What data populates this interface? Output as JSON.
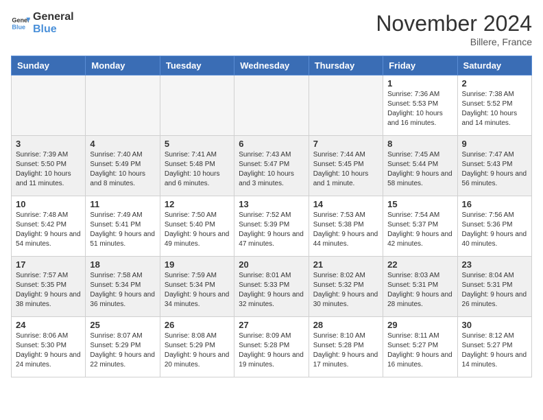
{
  "header": {
    "logo_general": "General",
    "logo_blue": "Blue",
    "month_title": "November 2024",
    "location": "Billere, France"
  },
  "weekdays": [
    "Sunday",
    "Monday",
    "Tuesday",
    "Wednesday",
    "Thursday",
    "Friday",
    "Saturday"
  ],
  "weeks": [
    [
      {
        "day": "",
        "info": ""
      },
      {
        "day": "",
        "info": ""
      },
      {
        "day": "",
        "info": ""
      },
      {
        "day": "",
        "info": ""
      },
      {
        "day": "",
        "info": ""
      },
      {
        "day": "1",
        "info": "Sunrise: 7:36 AM\nSunset: 5:53 PM\nDaylight: 10 hours and 16 minutes."
      },
      {
        "day": "2",
        "info": "Sunrise: 7:38 AM\nSunset: 5:52 PM\nDaylight: 10 hours and 14 minutes."
      }
    ],
    [
      {
        "day": "3",
        "info": "Sunrise: 7:39 AM\nSunset: 5:50 PM\nDaylight: 10 hours and 11 minutes."
      },
      {
        "day": "4",
        "info": "Sunrise: 7:40 AM\nSunset: 5:49 PM\nDaylight: 10 hours and 8 minutes."
      },
      {
        "day": "5",
        "info": "Sunrise: 7:41 AM\nSunset: 5:48 PM\nDaylight: 10 hours and 6 minutes."
      },
      {
        "day": "6",
        "info": "Sunrise: 7:43 AM\nSunset: 5:47 PM\nDaylight: 10 hours and 3 minutes."
      },
      {
        "day": "7",
        "info": "Sunrise: 7:44 AM\nSunset: 5:45 PM\nDaylight: 10 hours and 1 minute."
      },
      {
        "day": "8",
        "info": "Sunrise: 7:45 AM\nSunset: 5:44 PM\nDaylight: 9 hours and 58 minutes."
      },
      {
        "day": "9",
        "info": "Sunrise: 7:47 AM\nSunset: 5:43 PM\nDaylight: 9 hours and 56 minutes."
      }
    ],
    [
      {
        "day": "10",
        "info": "Sunrise: 7:48 AM\nSunset: 5:42 PM\nDaylight: 9 hours and 54 minutes."
      },
      {
        "day": "11",
        "info": "Sunrise: 7:49 AM\nSunset: 5:41 PM\nDaylight: 9 hours and 51 minutes."
      },
      {
        "day": "12",
        "info": "Sunrise: 7:50 AM\nSunset: 5:40 PM\nDaylight: 9 hours and 49 minutes."
      },
      {
        "day": "13",
        "info": "Sunrise: 7:52 AM\nSunset: 5:39 PM\nDaylight: 9 hours and 47 minutes."
      },
      {
        "day": "14",
        "info": "Sunrise: 7:53 AM\nSunset: 5:38 PM\nDaylight: 9 hours and 44 minutes."
      },
      {
        "day": "15",
        "info": "Sunrise: 7:54 AM\nSunset: 5:37 PM\nDaylight: 9 hours and 42 minutes."
      },
      {
        "day": "16",
        "info": "Sunrise: 7:56 AM\nSunset: 5:36 PM\nDaylight: 9 hours and 40 minutes."
      }
    ],
    [
      {
        "day": "17",
        "info": "Sunrise: 7:57 AM\nSunset: 5:35 PM\nDaylight: 9 hours and 38 minutes."
      },
      {
        "day": "18",
        "info": "Sunrise: 7:58 AM\nSunset: 5:34 PM\nDaylight: 9 hours and 36 minutes."
      },
      {
        "day": "19",
        "info": "Sunrise: 7:59 AM\nSunset: 5:34 PM\nDaylight: 9 hours and 34 minutes."
      },
      {
        "day": "20",
        "info": "Sunrise: 8:01 AM\nSunset: 5:33 PM\nDaylight: 9 hours and 32 minutes."
      },
      {
        "day": "21",
        "info": "Sunrise: 8:02 AM\nSunset: 5:32 PM\nDaylight: 9 hours and 30 minutes."
      },
      {
        "day": "22",
        "info": "Sunrise: 8:03 AM\nSunset: 5:31 PM\nDaylight: 9 hours and 28 minutes."
      },
      {
        "day": "23",
        "info": "Sunrise: 8:04 AM\nSunset: 5:31 PM\nDaylight: 9 hours and 26 minutes."
      }
    ],
    [
      {
        "day": "24",
        "info": "Sunrise: 8:06 AM\nSunset: 5:30 PM\nDaylight: 9 hours and 24 minutes."
      },
      {
        "day": "25",
        "info": "Sunrise: 8:07 AM\nSunset: 5:29 PM\nDaylight: 9 hours and 22 minutes."
      },
      {
        "day": "26",
        "info": "Sunrise: 8:08 AM\nSunset: 5:29 PM\nDaylight: 9 hours and 20 minutes."
      },
      {
        "day": "27",
        "info": "Sunrise: 8:09 AM\nSunset: 5:28 PM\nDaylight: 9 hours and 19 minutes."
      },
      {
        "day": "28",
        "info": "Sunrise: 8:10 AM\nSunset: 5:28 PM\nDaylight: 9 hours and 17 minutes."
      },
      {
        "day": "29",
        "info": "Sunrise: 8:11 AM\nSunset: 5:27 PM\nDaylight: 9 hours and 16 minutes."
      },
      {
        "day": "30",
        "info": "Sunrise: 8:12 AM\nSunset: 5:27 PM\nDaylight: 9 hours and 14 minutes."
      }
    ]
  ]
}
